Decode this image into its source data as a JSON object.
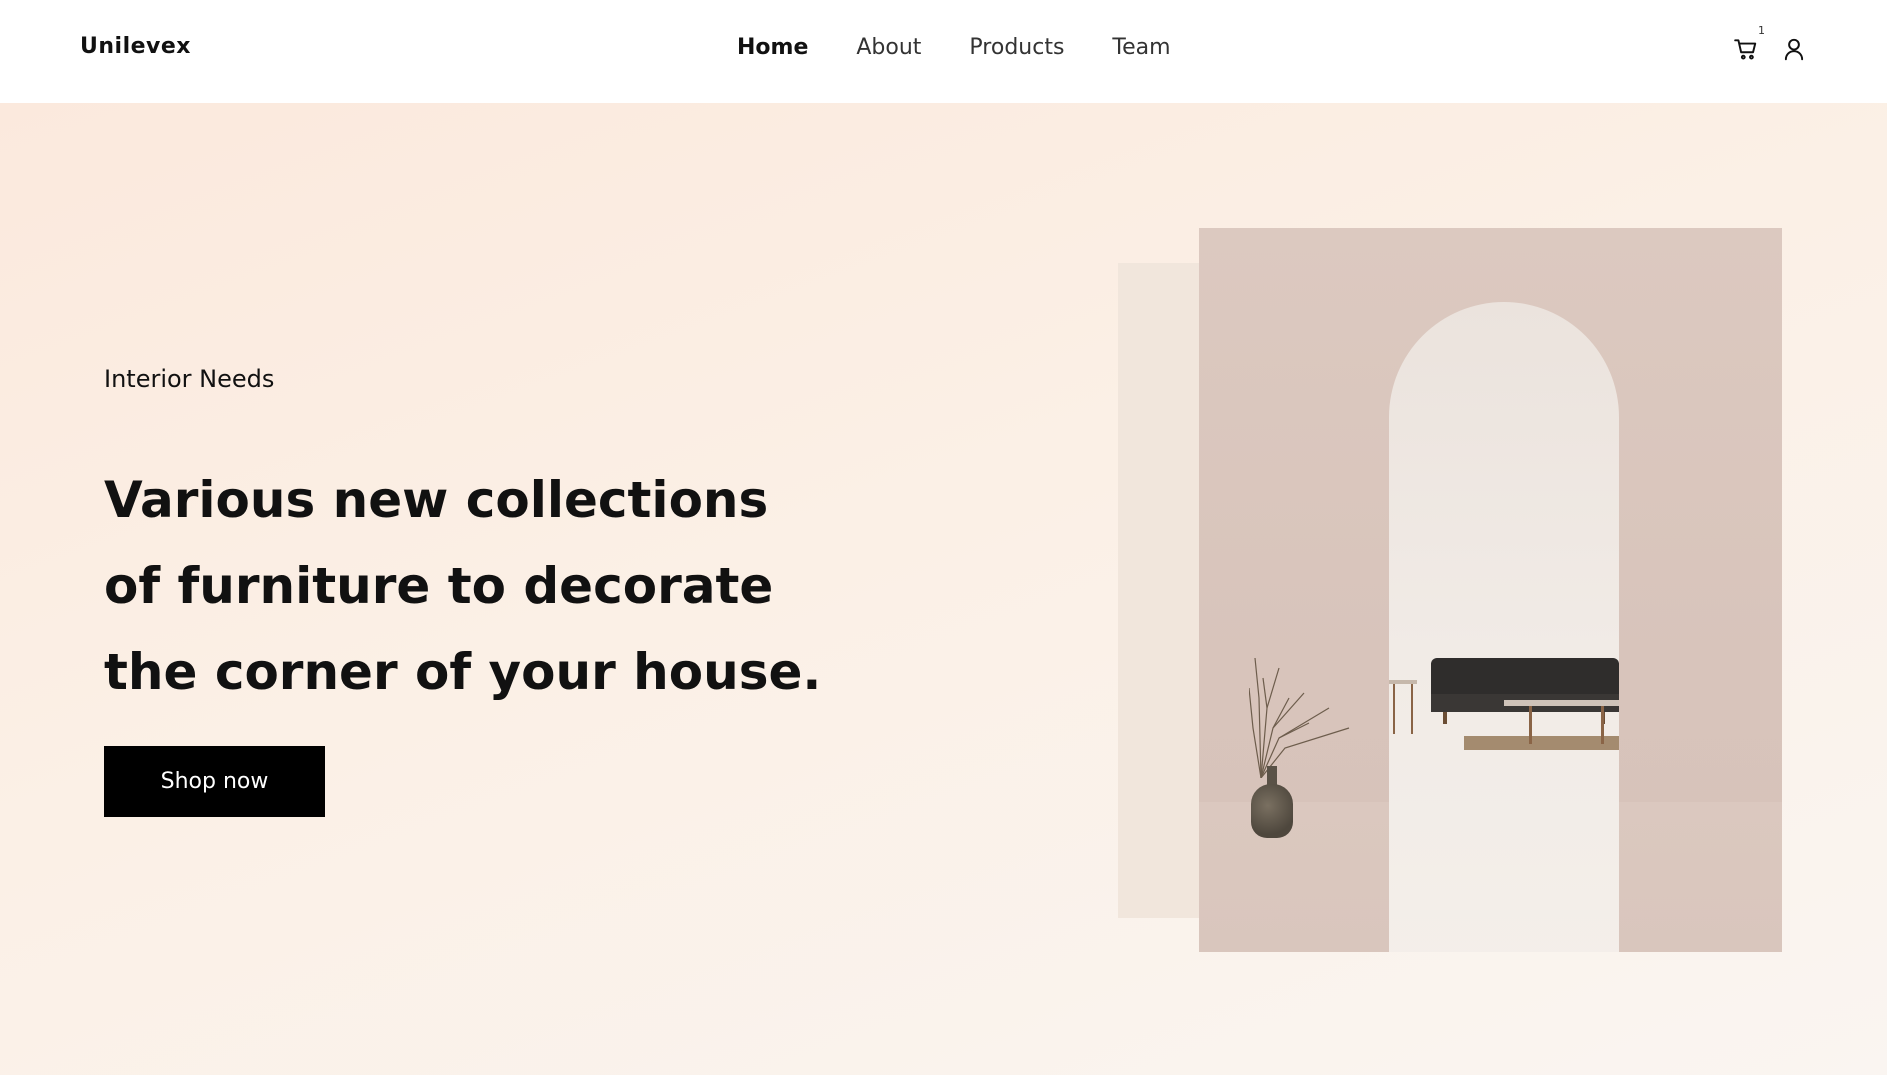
{
  "navbar": {
    "brand": "Unilevex",
    "links": [
      {
        "label": "Home",
        "active": true
      },
      {
        "label": "About",
        "active": false
      },
      {
        "label": "Products",
        "active": false
      },
      {
        "label": "Team",
        "active": false
      }
    ],
    "cart_count": "1",
    "icons": [
      "cart-icon",
      "user-icon"
    ]
  },
  "hero": {
    "eyebrow": "Interior Needs",
    "headline": "Various new collections of furniture to decorate the corner of your house.",
    "cta_label": "Shop now",
    "image_icon": "interior-room-photo"
  },
  "colors": {
    "accent": "#000000",
    "hero_bg_start": "#fbe9dd",
    "hero_bg_end": "#faf5f1",
    "text": "#111111"
  }
}
